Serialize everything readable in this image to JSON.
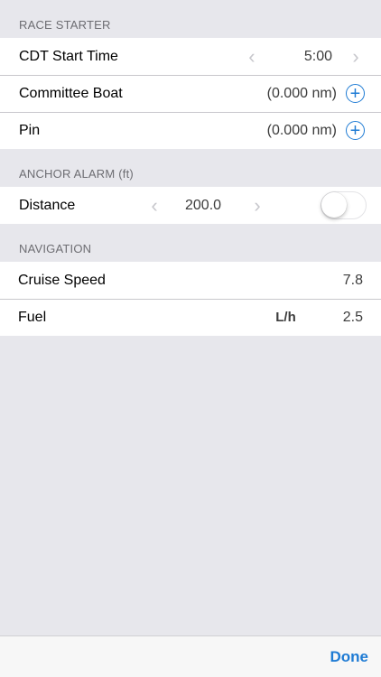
{
  "sections": {
    "race_starter": {
      "header": "RACE STARTER",
      "start_time": {
        "label": "CDT Start Time",
        "value": "5:00"
      },
      "committee_boat": {
        "label": "Committee Boat",
        "value": "(0.000 nm)"
      },
      "pin": {
        "label": "Pin",
        "value": "(0.000 nm)"
      }
    },
    "anchor_alarm": {
      "header": "ANCHOR ALARM (ft)",
      "distance": {
        "label": "Distance",
        "value": "200.0",
        "enabled": false
      }
    },
    "navigation": {
      "header": "NAVIGATION",
      "cruise_speed": {
        "label": "Cruise Speed",
        "value": "7.8"
      },
      "fuel": {
        "label": "Fuel",
        "unit": "L/h",
        "value": "2.5"
      }
    }
  },
  "toolbar": {
    "done_label": "Done"
  },
  "icons": {
    "prev": "chevron-left-icon",
    "next": "chevron-right-icon",
    "add": "plus-circle-icon"
  },
  "colors": {
    "accent": "#1e7bd4",
    "background": "#e7e7ec"
  }
}
